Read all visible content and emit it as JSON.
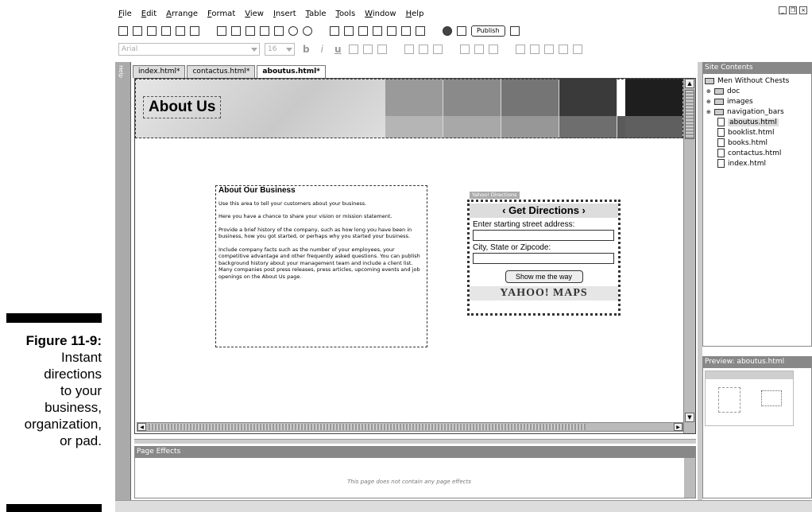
{
  "caption": {
    "figure": "Figure 11-9:",
    "lines": [
      "Instant",
      "directions",
      "to your",
      "business,",
      "organization,",
      "or pad."
    ]
  },
  "menu": [
    "File",
    "Edit",
    "Arrange",
    "Format",
    "View",
    "Insert",
    "Table",
    "Tools",
    "Window",
    "Help"
  ],
  "toolbar": {
    "publish_label": "Publish"
  },
  "format_bar": {
    "font": "Arial",
    "size": "16",
    "bold": "b",
    "italic": "i",
    "underline": "u"
  },
  "tabs": [
    "index.html*",
    "contactus.html*",
    "aboutus.html*"
  ],
  "left_strip": {
    "help": "Help"
  },
  "page": {
    "banner_title": "About Us",
    "swatch_colors_top": [
      "#9a9a9a",
      "#8a8a8a",
      "#757575",
      "#3a3a3a",
      "#ffffff",
      "#1e1e1e"
    ],
    "swatch_colors_bottom": [
      "#b5b5b5",
      "#a8a8a8",
      "#979797",
      "#6e6e6e",
      "#5a5a5a",
      "#5f5f5f"
    ],
    "heading": "About Our Business",
    "paragraphs": [
      "Use this area to tell your customers about your business.",
      "Here you have a chance to share your vision or mission statement.",
      "Provide a brief history of the company, such as how long you have been in business, how you got started, or perhaps why you started your business.",
      "Include company facts such as the number of your employees, your competitive advantage and other frequently asked questions. You can publish background history about your management team and include a client list. Many companies post press releases, press articles, upcoming events and job openings on the About Us page."
    ]
  },
  "yahoo": {
    "tag": "Yahoo! Directions",
    "header": "‹ Get Directions ›",
    "address_label": "Enter starting street address:",
    "city_label": "City, State or Zipcode:",
    "button": "Show me the way",
    "logo": "YAHOO! MAPS"
  },
  "effects": {
    "title": "Page Effects",
    "message": "This page does not contain any page effects"
  },
  "site": {
    "title": "Site Contents",
    "root": "Men Without Chests",
    "folders": [
      "doc",
      "images",
      "navigation_bars"
    ],
    "files": [
      "aboutus.html",
      "booklist.html",
      "books.html",
      "contactus.html",
      "index.html"
    ]
  },
  "preview": {
    "title": "Preview: aboutus.html"
  }
}
